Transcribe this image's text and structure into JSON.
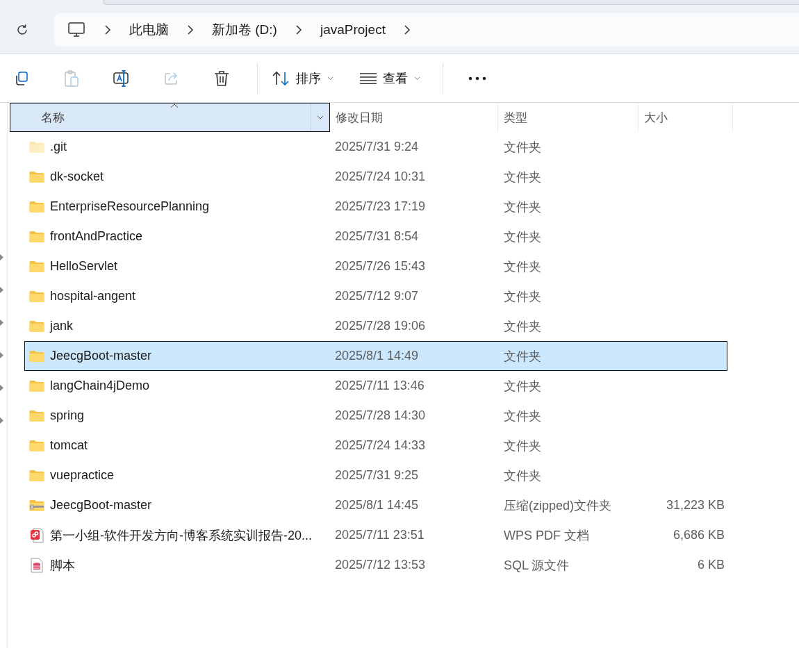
{
  "address_bar": {
    "crumbs": [
      "此电脑",
      "新加卷 (D:)",
      "javaProject"
    ]
  },
  "toolbar": {
    "tools": [
      {
        "kind": "copy",
        "disabled": false
      },
      {
        "kind": "paste",
        "disabled": true
      },
      {
        "kind": "rename",
        "disabled": false
      },
      {
        "kind": "share",
        "disabled": true
      },
      {
        "kind": "delete",
        "disabled": false
      }
    ],
    "sort": {
      "label": "排序"
    },
    "view": {
      "label": "查看"
    }
  },
  "columns": [
    {
      "label": "名称",
      "sorted": true,
      "selected": true
    },
    {
      "label": "修改日期",
      "sorted": false,
      "selected": false
    },
    {
      "label": "类型",
      "sorted": false,
      "selected": false
    },
    {
      "label": "大小",
      "sorted": false,
      "selected": false
    }
  ],
  "rows": [
    {
      "kind": "folder",
      "name": ".git",
      "hidden": true,
      "date": "2025/7/31 9:24",
      "type": "文件夹",
      "selected": false
    },
    {
      "kind": "folder",
      "name": "dk-socket",
      "hidden": false,
      "date": "2025/7/24 10:31",
      "type": "文件夹",
      "selected": false
    },
    {
      "kind": "folder",
      "name": "EnterpriseResourcePlanning",
      "hidden": false,
      "date": "2025/7/23 17:19",
      "type": "文件夹",
      "selected": false
    },
    {
      "kind": "folder",
      "name": "frontAndPractice",
      "hidden": false,
      "date": "2025/7/31 8:54",
      "type": "文件夹",
      "selected": false
    },
    {
      "kind": "folder",
      "name": "HelloServlet",
      "hidden": false,
      "date": "2025/7/26 15:43",
      "type": "文件夹",
      "selected": false
    },
    {
      "kind": "folder",
      "name": "hospital-angent",
      "hidden": false,
      "date": "2025/7/12 9:07",
      "type": "文件夹",
      "selected": false
    },
    {
      "kind": "folder",
      "name": "jank",
      "hidden": false,
      "date": "2025/7/28 19:06",
      "type": "文件夹",
      "selected": false
    },
    {
      "kind": "folder",
      "name": "JeecgBoot-master",
      "hidden": false,
      "date": "2025/8/1 14:49",
      "type": "文件夹",
      "selected": true
    },
    {
      "kind": "folder",
      "name": "langChain4jDemo",
      "hidden": false,
      "date": "2025/7/11 13:46",
      "type": "文件夹",
      "selected": false
    },
    {
      "kind": "folder",
      "name": "spring",
      "hidden": false,
      "date": "2025/7/28 14:30",
      "type": "文件夹",
      "selected": false
    },
    {
      "kind": "folder",
      "name": "tomcat",
      "hidden": false,
      "date": "2025/7/24 14:33",
      "type": "文件夹",
      "selected": false
    },
    {
      "kind": "folder",
      "name": "vuepractice",
      "hidden": false,
      "date": "2025/7/31 9:25",
      "type": "文件夹",
      "selected": false
    },
    {
      "kind": "zip",
      "name": "JeecgBoot-master",
      "hidden": false,
      "date": "2025/8/1 14:45",
      "type": "压缩(zipped)文件夹",
      "size": "31,223 KB",
      "selected": false
    },
    {
      "kind": "pdf",
      "name": "第一小组-软件开发方向-博客系统实训报告-20...",
      "hidden": false,
      "date": "2025/7/11 23:51",
      "type": "WPS PDF 文档",
      "size": "6,686 KB",
      "selected": false
    },
    {
      "kind": "sql",
      "name": "脚本",
      "hidden": false,
      "date": "2025/7/12 13:53",
      "type": "SQL 源文件",
      "size": "6 KB",
      "selected": false
    }
  ]
}
